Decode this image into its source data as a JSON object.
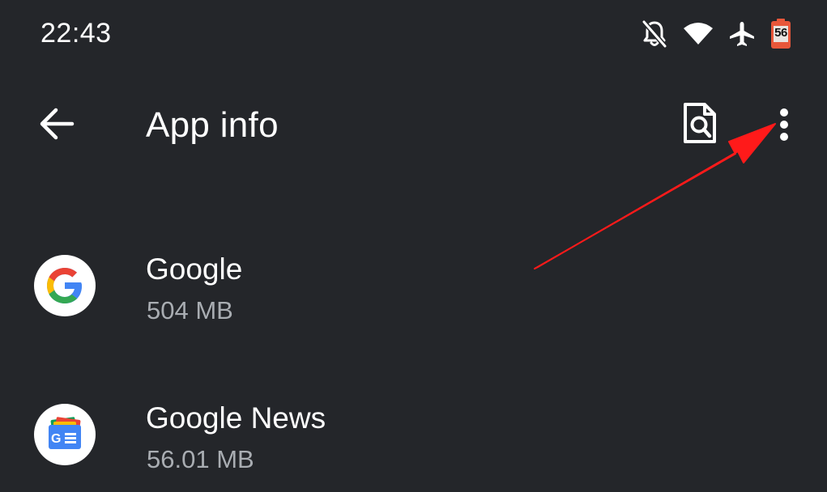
{
  "status_bar": {
    "time": "22:43",
    "icons": [
      "notifications-off-icon",
      "wifi-icon",
      "airplane-mode-icon",
      "battery-icon"
    ],
    "battery_level": "56",
    "battery_color": "#e8573a"
  },
  "app_bar": {
    "title": "App info",
    "back_icon": "back-arrow-icon",
    "search_icon": "document-search-icon",
    "menu_icon": "more-vert-icon"
  },
  "apps": [
    {
      "name": "Google",
      "size": "504 MB",
      "icon": "google-g-icon"
    },
    {
      "name": "Google News",
      "size": "56.01 MB",
      "icon": "google-news-icon"
    }
  ],
  "annotation": {
    "type": "arrow",
    "color": "#ff1a1a",
    "points_to": "more-vert-icon"
  },
  "colors": {
    "background": "#24262a",
    "primary_text": "#ffffff",
    "secondary_text": "#a9adb2"
  }
}
